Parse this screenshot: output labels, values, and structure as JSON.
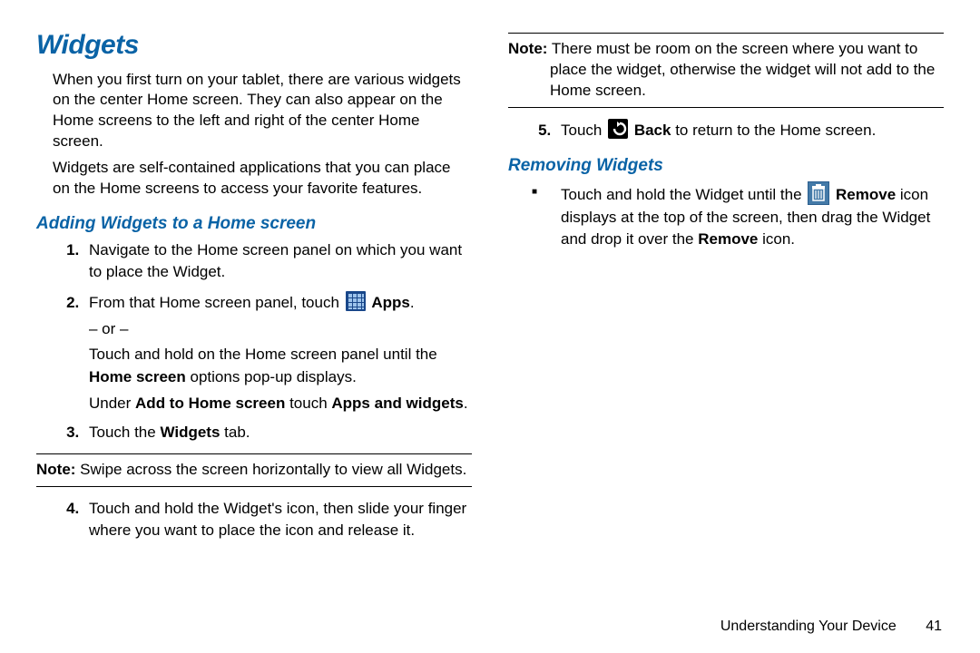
{
  "left": {
    "h1": "Widgets",
    "p1": "When you first turn on your tablet, there are various widgets on the center Home screen. They can also appear on the Home screens to the left and right of the center Home screen.",
    "p2": "Widgets are self-contained applications that you can place on the Home screens to access your favorite features.",
    "h2": "Adding Widgets to a Home screen",
    "s1": "Navigate to the Home screen panel on which you want to place the Widget.",
    "s2a": "From that Home screen panel, touch ",
    "s2apps": "Apps",
    "s2dot": ".",
    "s2or": "– or –",
    "s2b": "Touch and hold on the Home screen panel until the ",
    "s2home": "Home screen",
    "s2b2": " options pop-up displays.",
    "s2c1": "Under ",
    "s2c_b1": "Add to Home screen",
    "s2c2": " touch ",
    "s2c_b2": "Apps and widgets",
    "s2c3": ".",
    "s3a": "Touch the ",
    "s3b": "Widgets",
    "s3c": " tab.",
    "noteLabel": "Note:",
    "note": " Swipe across the screen horizontally to view all Widgets.",
    "s4": "Touch and hold the Widget's icon, then slide your finger where you want to place the icon and release it."
  },
  "right": {
    "noteLabel": "Note:",
    "note": " There must be room on the screen where you want to place the widget, otherwise the widget will not add to the Home screen.",
    "s5a": "Touch ",
    "s5b": "Back",
    "s5c": " to return to the Home screen.",
    "h2": "Removing Widgets",
    "bul_a": "Touch and hold the Widget until the ",
    "bul_remove1": "Remove",
    "bul_b": " icon displays at the top of the screen, then drag the Widget and drop it over the ",
    "bul_remove2": "Remove",
    "bul_c": " icon."
  },
  "footer": {
    "section": "Understanding Your Device",
    "page": "41"
  }
}
